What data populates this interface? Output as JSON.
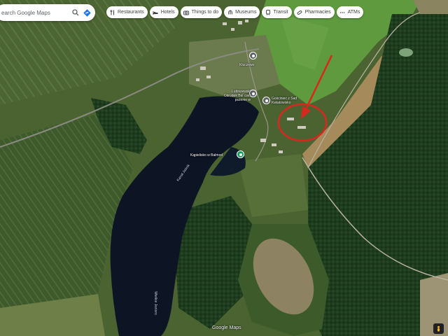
{
  "search": {
    "placeholder": "earch Google Maps"
  },
  "chips": [
    {
      "label": "Restaurants",
      "icon": "fork-knife-icon"
    },
    {
      "label": "Hotels",
      "icon": "bed-icon"
    },
    {
      "label": "Things to do",
      "icon": "camera-icon"
    },
    {
      "label": "Museums",
      "icon": "museum-icon"
    },
    {
      "label": "Transit",
      "icon": "train-icon"
    },
    {
      "label": "Pharmacies",
      "icon": "pill-icon"
    },
    {
      "label": "ATMs",
      "icon": "more-dots-icon"
    }
  ],
  "places": [
    {
      "label": "Kluczewo"
    },
    {
      "label": "Lubiszewski Ośrodek Bal ciad pszenie w"
    },
    {
      "label": "Gościniec z Sad Kwiatowisko"
    },
    {
      "label": "Kąpielisko w Balmod"
    }
  ],
  "water_labels": [
    {
      "label": "Kanał Jaśnik"
    },
    {
      "label": "Wielkie Jezioro"
    }
  ],
  "watermark": "Google Maps",
  "colors": {
    "annotation": "#d8281e",
    "lake": "#0d1424",
    "forest": "#1f3a1c",
    "field": "#6f8a45",
    "chip_text": "#3c4043"
  }
}
